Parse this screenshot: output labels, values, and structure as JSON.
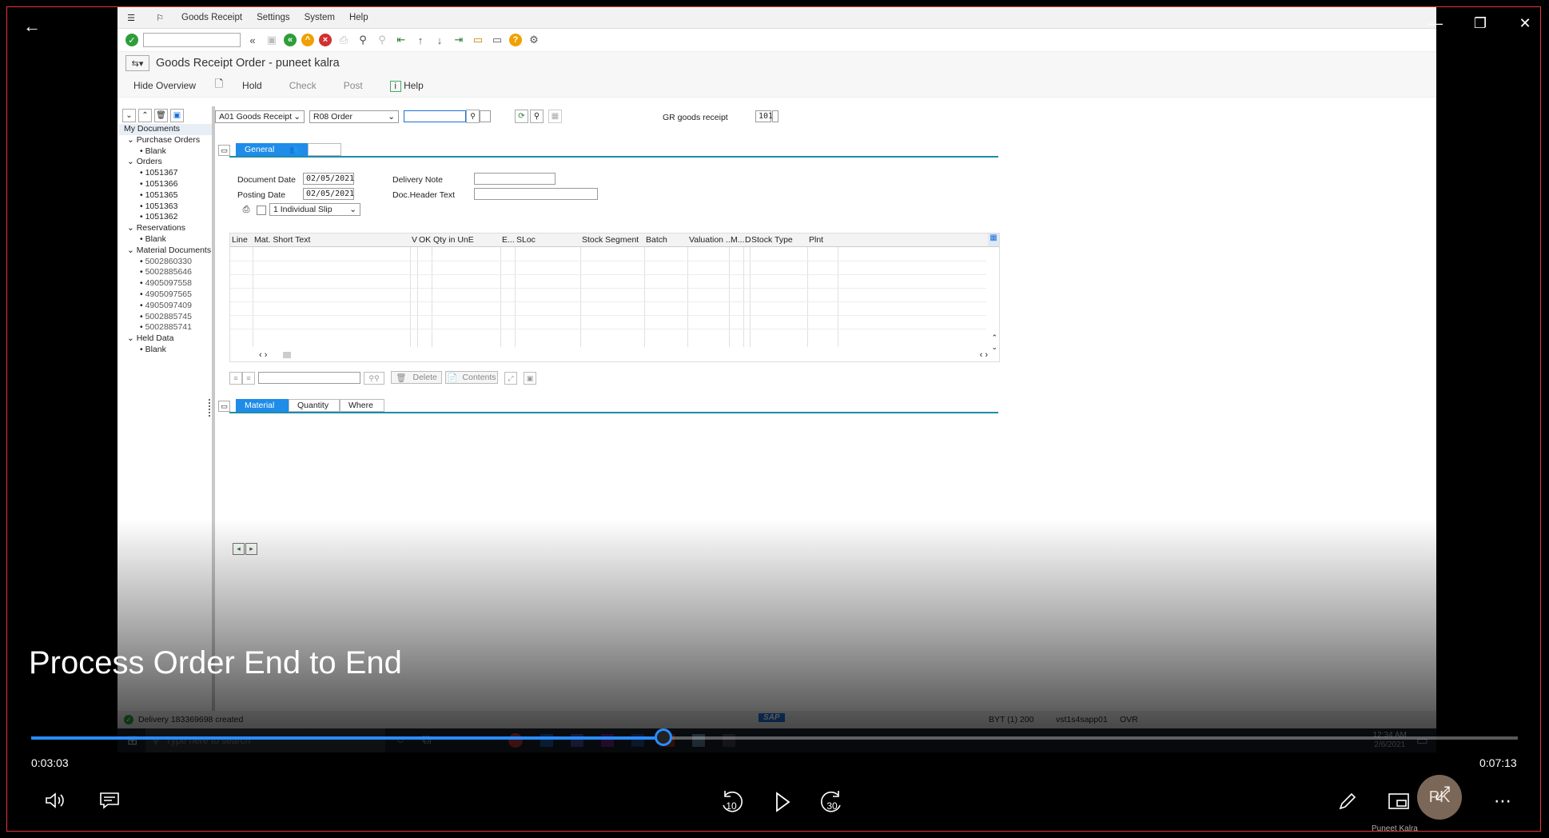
{
  "sap": {
    "menu": [
      "Goods Receipt",
      "Settings",
      "System",
      "Help"
    ],
    "title": "Goods Receipt Order - puneet kalra",
    "app_toolbar": {
      "hide_overview": "Hide Overview",
      "hold": "Hold",
      "check": "Check",
      "post": "Post",
      "help": "Help"
    },
    "selectors": {
      "action": "A01 Goods Receipt",
      "ref_doc": "R08 Order",
      "gr_label": "GR goods receipt",
      "movement_type": "101"
    },
    "tree": [
      {
        "label": "My Documents",
        "level": 0
      },
      {
        "label": "Purchase Orders",
        "level": 1,
        "expand": true
      },
      {
        "label": "Blank",
        "level": 2
      },
      {
        "label": "Orders",
        "level": 1,
        "expand": true
      },
      {
        "label": "1051367",
        "level": 2
      },
      {
        "label": "1051366",
        "level": 2
      },
      {
        "label": "1051365",
        "level": 2
      },
      {
        "label": "1051363",
        "level": 2
      },
      {
        "label": "1051362",
        "level": 2
      },
      {
        "label": "Reservations",
        "level": 1,
        "expand": true
      },
      {
        "label": "Blank",
        "level": 2
      },
      {
        "label": "Material Documents",
        "level": 1,
        "expand": true
      },
      {
        "label": "5002860330",
        "level": 2
      },
      {
        "label": "5002885646",
        "level": 2
      },
      {
        "label": "4905097558",
        "level": 2
      },
      {
        "label": "4905097565",
        "level": 2
      },
      {
        "label": "4905097409",
        "level": 2
      },
      {
        "label": "5002885745",
        "level": 2
      },
      {
        "label": "5002885741",
        "level": 2
      },
      {
        "label": "Held Data",
        "level": 1,
        "expand": true
      },
      {
        "label": "Blank",
        "level": 2
      }
    ],
    "header_tabs": [
      "General"
    ],
    "general": {
      "document_date_label": "Document Date",
      "document_date": "02/05/2021",
      "posting_date_label": "Posting Date",
      "posting_date": "02/05/2021",
      "delivery_note_label": "Delivery Note",
      "doc_header_text_label": "Doc.Header Text",
      "slip": "1 Individual Slip"
    },
    "grid_columns": [
      "Line",
      "Mat. Short Text",
      "V",
      "OK",
      "Qty in UnE",
      "E...",
      "SLoc",
      "Stock Segment",
      "Batch",
      "Valuation ...",
      "M...",
      "D",
      "Stock Type",
      "Plnt"
    ],
    "grid_buttons": {
      "delete": "Delete",
      "contents": "Contents"
    },
    "detail_tabs": [
      "Material",
      "Quantity",
      "Where"
    ],
    "status_message": "Delivery 183369698 created",
    "status_right": "BYT (1) 200",
    "status_server": "vst1s4sapp01",
    "status_mode": "OVR",
    "brand": "SAP"
  },
  "taskbar": {
    "search_placeholder": "Type here to search",
    "time": "12:34 AM",
    "date": "2/6/2021"
  },
  "player": {
    "title": "Process Order End to End",
    "elapsed": "0:03:03",
    "duration": "0:07:13",
    "progress": 0.425,
    "skip_back": "10",
    "skip_forward": "30",
    "user_initials": "PK",
    "user_name": "Puneet Kalra"
  }
}
